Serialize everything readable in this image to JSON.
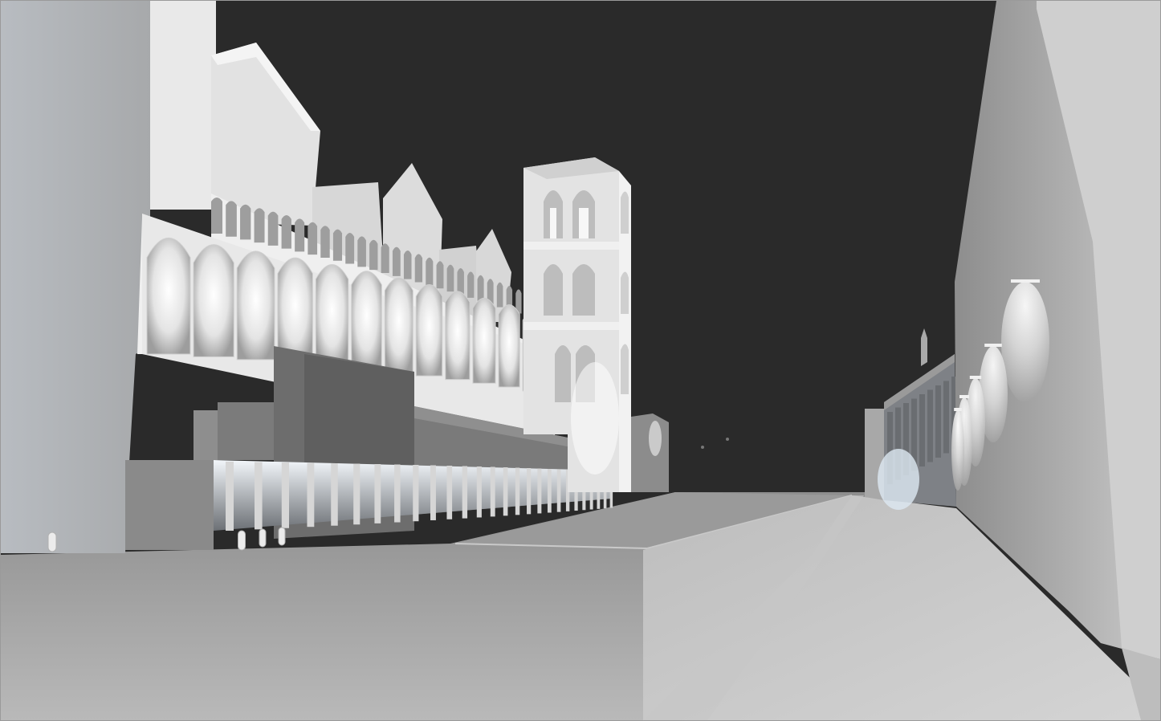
{
  "viewport": {
    "kind": "lighting-render",
    "description_hidden": true
  },
  "palette": {
    "sky": "#2a2a2a",
    "ground": "#9c9c9c",
    "facade_light": "#e6e6e6",
    "facade_mid": "#bdbdbd",
    "facade_dark": "#6f6f6f",
    "glow": "#ffffff",
    "glow_blue": "#dfe9f2"
  },
  "bollards": {
    "count": 4
  }
}
